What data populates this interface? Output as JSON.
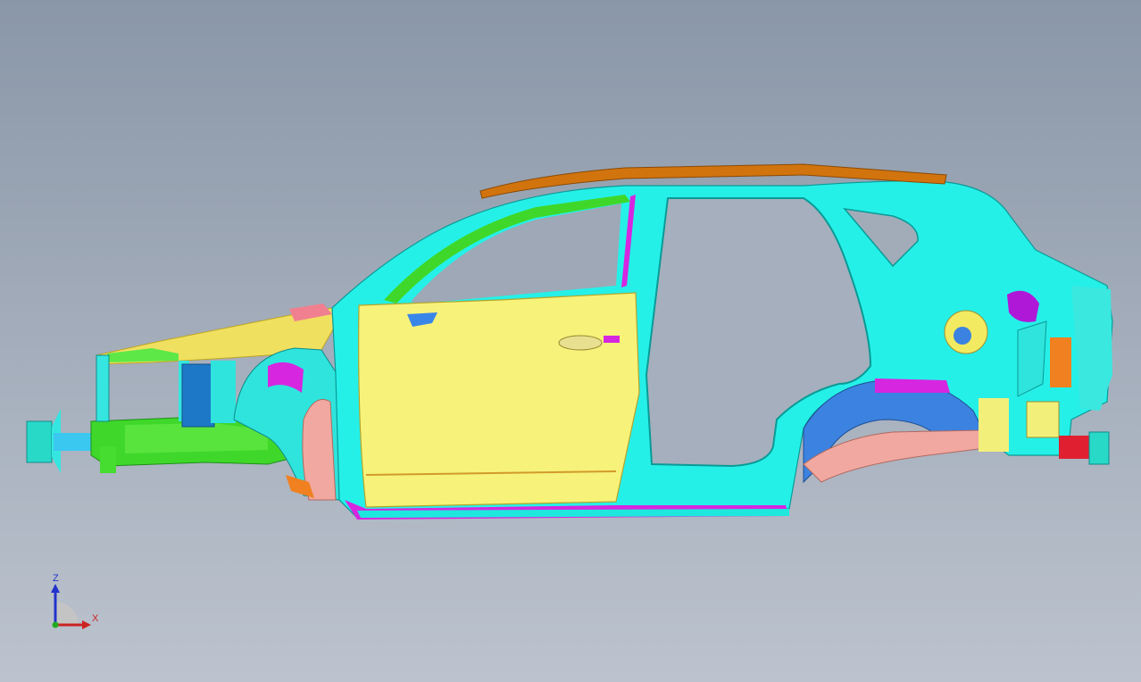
{
  "viewport": {
    "background_top": "#8a97a8",
    "background_bottom": "#bcc3ce"
  },
  "model": {
    "name": "",
    "colors": {
      "body_side": "#25f0e8",
      "front_door": "#f6f27a",
      "roof_rail": "#d2740e",
      "front_rail": "#3fd82a",
      "upper_rail": "#f0e060",
      "strut_tower": "#1e78c8",
      "wheelhouse_pink": "#f0a8a0",
      "accent_magenta": "#d626e0",
      "orange_parts": "#f08020",
      "rear_blue": "#3c82e0"
    }
  },
  "triad": {
    "z_label": "Z",
    "x_label": "X",
    "z_color": "#2233cc",
    "x_color": "#cc2222",
    "y_color": "#22aa22"
  }
}
